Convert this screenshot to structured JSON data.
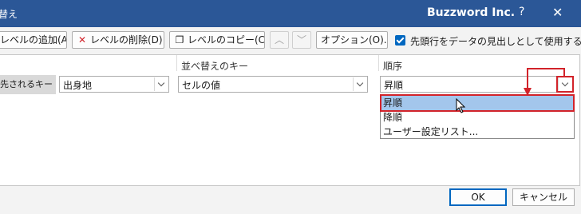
{
  "titlebar": {
    "title": "替え",
    "brand": "Buzzword Inc.",
    "help": "?",
    "close": "✕"
  },
  "toolbar": {
    "add_level": "レベルの追加(A)",
    "delete_level": "レベルの削除(D)",
    "copy_level": "レベルのコピー(C)",
    "move_up": "︿",
    "move_down": "﹀",
    "options": "オプション(O)...",
    "header_checkbox_label": "先頭行をデータの見出しとして使用する(H)",
    "header_checkbox_checked": true
  },
  "grid": {
    "headers": {
      "sort_on": "並べ替えのキー",
      "order": "順序"
    },
    "row": {
      "label": "先されるキー",
      "column": "出身地",
      "sort_on": "セルの値",
      "order": "昇順"
    }
  },
  "order_dropdown": {
    "options": [
      "昇順",
      "降順",
      "ユーザー設定リスト..."
    ],
    "selected_index": 0
  },
  "footer": {
    "ok": "OK",
    "cancel": "キャンセル"
  },
  "colors": {
    "titlebar": "#2b5797",
    "accent": "#0067c0",
    "highlight": "#d2232a",
    "selected": "#a3c6ec"
  }
}
